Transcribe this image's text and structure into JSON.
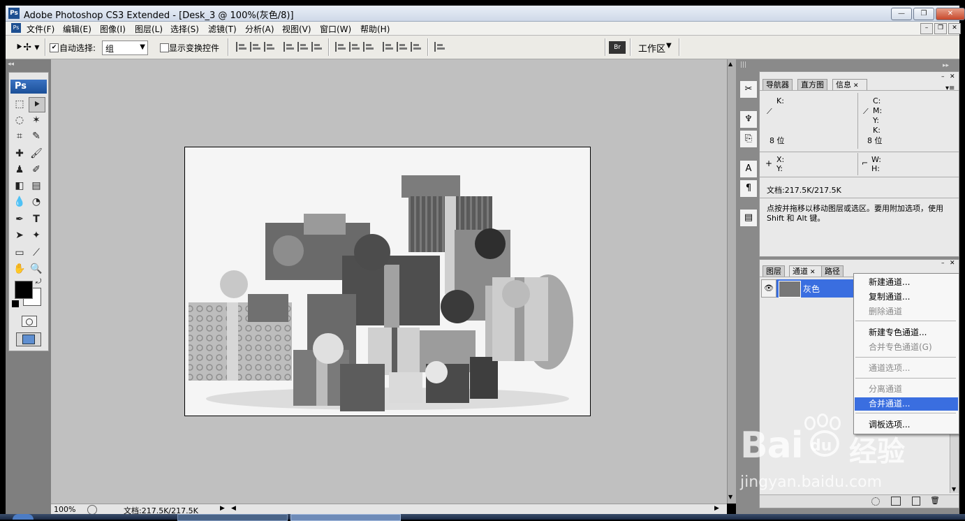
{
  "window": {
    "title": "Adobe Photoshop CS3 Extended - [Desk_3 @ 100%(灰色/8)]",
    "app_icon": "Ps",
    "buttons": [
      "minimize",
      "restore",
      "close"
    ]
  },
  "menu": [
    "文件(F)",
    "编辑(E)",
    "图像(I)",
    "图层(L)",
    "选择(S)",
    "滤镜(T)",
    "分析(A)",
    "视图(V)",
    "窗口(W)",
    "帮助(H)"
  ],
  "options_bar": {
    "auto_select_label": "自动选择:",
    "auto_select_checked": true,
    "auto_select_value": "组",
    "show_transform_label": "显示变换控件",
    "show_transform_checked": false,
    "workspace_label": "工作区"
  },
  "toolbox": {
    "logo": "Ps",
    "tools": [
      "marquee",
      "move",
      "lasso",
      "magic-wand",
      "crop",
      "slice",
      "healing",
      "brush",
      "stamp",
      "history-brush",
      "eraser",
      "gradient",
      "blur",
      "dodge",
      "pen",
      "type",
      "path-select",
      "shape",
      "notes",
      "eyedropper",
      "hand",
      "zoom"
    ],
    "fg_color": "#000000",
    "bg_color": "#ffffff"
  },
  "status": {
    "zoom": "100%",
    "doc_size": "文档:217.5K/217.5K"
  },
  "info_panel": {
    "tabs": [
      "导航器",
      "直方图",
      "信息"
    ],
    "active_tab": "信息",
    "left_channels": [
      "K:"
    ],
    "left_bits": "8 位",
    "right_channels": [
      "C:",
      "M:",
      "Y:",
      "K:"
    ],
    "right_bits": "8 位",
    "xy": [
      "X:",
      "Y:"
    ],
    "wh": [
      "W:",
      "H:"
    ],
    "doc_size": "文档:217.5K/217.5K",
    "hint": "点按并拖移以移动图层或选区。要用附加选项，使用 Shift 和 Alt 键。"
  },
  "channels_panel": {
    "tabs": [
      "图层",
      "通道",
      "路径"
    ],
    "active_tab": "通道",
    "channel_name": "灰色"
  },
  "context_menu": {
    "items": [
      {
        "label": "新建通道...",
        "disabled": false,
        "highlighted": false
      },
      {
        "label": "复制通道...",
        "disabled": false,
        "highlighted": false
      },
      {
        "label": "删除通道",
        "disabled": true,
        "highlighted": false
      },
      {
        "label": "新建专色通道...",
        "disabled": false,
        "highlighted": false
      },
      {
        "label": "合并专色通道(G)",
        "disabled": true,
        "highlighted": false
      },
      {
        "label": "通道选项...",
        "disabled": true,
        "highlighted": false
      },
      {
        "label": "分离通道",
        "disabled": true,
        "highlighted": false
      },
      {
        "label": "合并通道...",
        "disabled": false,
        "highlighted": true
      },
      {
        "label": "调板选项...",
        "disabled": false,
        "highlighted": false
      }
    ]
  },
  "watermark": {
    "brand": "Bai",
    "brand2": "du",
    "cn": "经验",
    "url": "jingyan.baidu.com"
  }
}
